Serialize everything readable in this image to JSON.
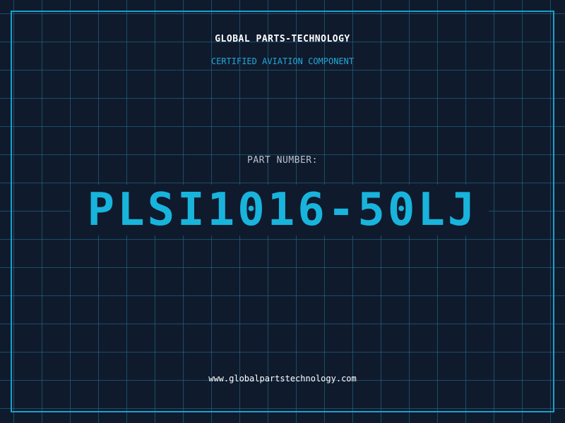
{
  "header": {
    "company": "GLOBAL PARTS-TECHNOLOGY",
    "tagline": "CERTIFIED AVIATION COMPONENT"
  },
  "part": {
    "label": "PART NUMBER:",
    "number": "PLSI1016-50LJ"
  },
  "footer": {
    "website": "www.globalpartstechnology.com"
  },
  "colors": {
    "background": "#101a2d",
    "grid": "#1f6f8f",
    "accent": "#18b4dc",
    "frame": "#1aa0cc",
    "text": "#ffffff",
    "muted": "#b8c2cc"
  }
}
